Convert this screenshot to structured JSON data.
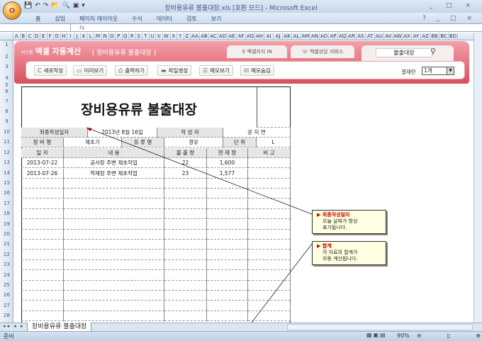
{
  "window": {
    "title": "장비용유류 불출대장.xls [호환 모드] - Microsoft Excel",
    "controls": "_ □ ×",
    "office_button": "O"
  },
  "qat": [
    "💾",
    "↶",
    "↷",
    "📂",
    "🔍",
    "▣",
    "▾"
  ],
  "ribbon": {
    "tabs": [
      "홈",
      "삽입",
      "페이지 레이아웃",
      "수식",
      "데이터",
      "검토",
      "보기"
    ],
    "controls": "? _ □ ×"
  },
  "formula_bar": {
    "fx": "fx",
    "name_box": ""
  },
  "columns": [
    "A",
    "B",
    "C",
    "D",
    "E",
    "F",
    "G",
    "H",
    "I",
    "J",
    "K",
    "L",
    "M",
    "N",
    "O",
    "P",
    "Q",
    "R",
    "S",
    "T",
    "U",
    "V",
    "W",
    "X",
    "Y",
    "Z",
    "AA",
    "AB",
    "AC",
    "AD",
    "AE",
    "AF",
    "AG",
    "AH",
    "AI",
    "AJ",
    "AK",
    "AL",
    "AM",
    "AN",
    "AO",
    "AP",
    "AQ",
    "AR",
    "AS",
    "AT",
    "AU",
    "AV",
    "AW",
    "AX",
    "AY",
    "AZ",
    "BB",
    "BC",
    "BD"
  ],
  "banner": {
    "brand_small": "비즈폼",
    "brand": "엑셀 자동계산",
    "subtitle": "[ 장비용유류 불출대장 ]",
    "links": [
      "엑셀지식 IN",
      "엑셀상담 서비스"
    ],
    "search_value": "불출대장"
  },
  "toolbar": {
    "buttons": [
      {
        "icon": "C",
        "label": "새로작성"
      },
      {
        "icon": "▭",
        "label": "미리보기"
      },
      {
        "icon": "⎙",
        "label": "출력하기"
      },
      {
        "icon": "▬",
        "label": "파일생성"
      },
      {
        "icon": "☰",
        "label": "메모보기"
      },
      {
        "icon": "☒",
        "label": "메모숨김"
      }
    ],
    "approval_label": "결재란",
    "approval_value": "1개"
  },
  "document": {
    "title": "장비용유류 불출대장",
    "info1": {
      "last_date_label": "최종작성일자",
      "last_date": "2013년 8월 16일",
      "author_label": "작 성 자",
      "author": "윤 지 연"
    },
    "info2": {
      "equip_label": "장 비 명",
      "equip": "제초기",
      "fuel_label": "유 류 명",
      "fuel": "경유",
      "unit_label": "단 위",
      "unit": "L"
    },
    "headers": [
      "일   자",
      "내          용",
      "불 출 량",
      "현 재 량",
      "비   고"
    ],
    "rows": [
      [
        "2013-07-22",
        "공사장 주변 제초작업",
        "22",
        "1,600",
        ""
      ],
      [
        "2013-07-26",
        "적재장 주변 제초작업",
        "23",
        "1,577",
        ""
      ]
    ]
  },
  "notes": [
    {
      "title": "최종작성일자",
      "lines": [
        "오늘 날짜가 항상",
        "표기됩니다."
      ]
    },
    {
      "title": "합계",
      "lines": [
        "각 자료의 합계가",
        "자동 계산됩니다."
      ]
    }
  ],
  "sheet": {
    "tab": "장비용유류 불출대장",
    "nav": "◂◂ ◂ ▸ ▸▸"
  },
  "status": {
    "ready": "준비",
    "zoom": "90%",
    "views": "▦▣▤"
  },
  "row_numbers": [
    "1",
    "2",
    "3",
    "4",
    "5",
    "6",
    "7",
    "8",
    "9",
    "10",
    "11",
    "12",
    "13",
    "14",
    "15",
    "16",
    "17",
    "18",
    "19",
    "20",
    "21",
    "22",
    "23",
    "24",
    "25",
    "26",
    "27",
    "28"
  ]
}
